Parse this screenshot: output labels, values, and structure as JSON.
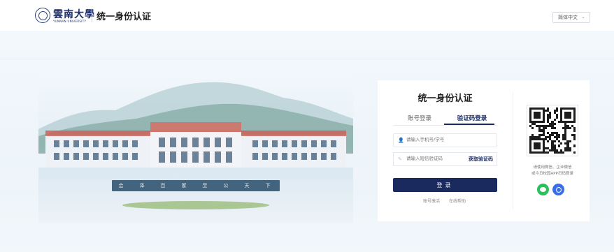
{
  "header": {
    "logo_text": "雲南大學",
    "logo_sub": "YUNNAN UNIVERSITY",
    "title": "统一身份认证",
    "language": "简体中文"
  },
  "campus": {
    "motto": [
      "会",
      "泽",
      "百",
      "家",
      "至",
      "公",
      "天",
      "下"
    ]
  },
  "login": {
    "title": "统一身份认证",
    "tabs": [
      {
        "label": "账号登录",
        "active": false
      },
      {
        "label": "验证码登录",
        "active": true
      }
    ],
    "phone_placeholder": "请输入手机号/学号",
    "code_placeholder": "请输入短信验证码",
    "get_code_label": "获取验证码",
    "submit_label": "登录",
    "links": {
      "activate": "账号激活",
      "help": "在线帮助"
    }
  },
  "qr": {
    "hint_line1": "请使用微信、企业微信",
    "hint_line2": "或今日校园APP扫码登录"
  },
  "colors": {
    "primary": "#1a2a5e",
    "wechat": "#27c25e",
    "wecom": "#3a6ee8",
    "background": "#edf4fa"
  },
  "icons": {
    "lang_dropdown": "chevron-down-icon",
    "phone_field": "user-icon",
    "code_field": "pencil-icon",
    "wechat": "wechat-icon",
    "wecom": "wecom-icon"
  }
}
